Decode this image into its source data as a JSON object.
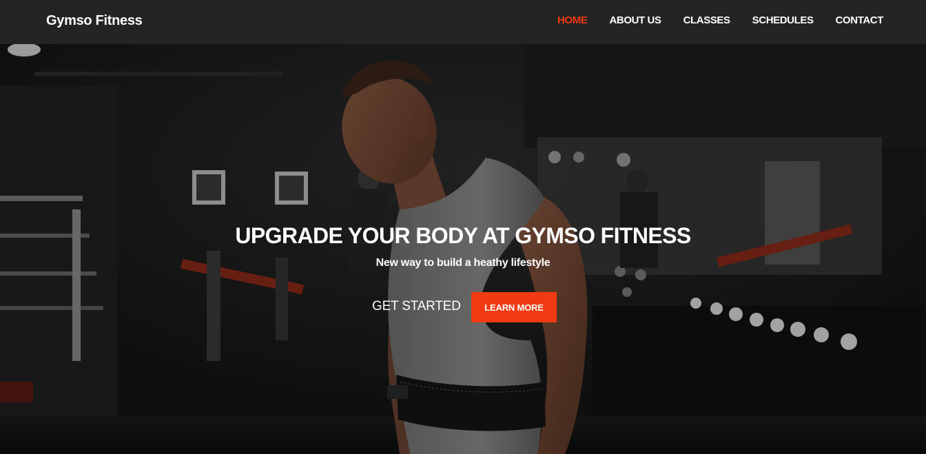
{
  "brand": {
    "name": "Gymso Fitness"
  },
  "nav": {
    "items": [
      {
        "label": "HOME",
        "active": true
      },
      {
        "label": "ABOUT US",
        "active": false
      },
      {
        "label": "CLASSES",
        "active": false
      },
      {
        "label": "SCHEDULES",
        "active": false
      },
      {
        "label": "CONTACT",
        "active": false
      }
    ]
  },
  "hero": {
    "title": "UPGRADE YOUR BODY AT GYMSO FITNESS",
    "subtitle": "New way to build a heathy lifestyle",
    "primary_cta": "GET STARTED",
    "secondary_cta": "LEARN MORE"
  },
  "colors": {
    "accent": "#f13a11",
    "navbar_bg": "#242424",
    "text": "#ffffff"
  }
}
